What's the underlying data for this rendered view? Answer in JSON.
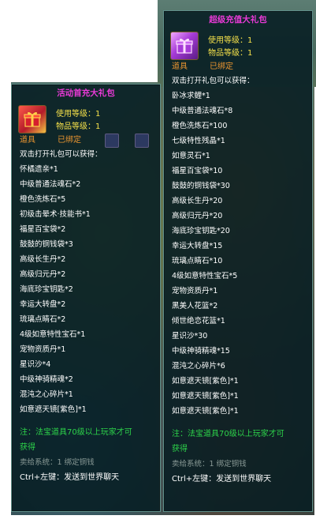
{
  "left_tooltip": {
    "title": "活动首充大礼包",
    "use_level": "使用等级：1",
    "item_level": "物品等级：1",
    "type_label": "道具",
    "bound_label": "已绑定",
    "description": "双击打开礼包可以获得：",
    "items": [
      "怀橘遗亲*1",
      "中级普通法魂石*2",
      "橙色洗炼石*5",
      "初级击晕术·技能书*1",
      "福星百宝袋*2",
      "鼓鼓的铜钱袋*3",
      "高级长生丹*2",
      "高级归元丹*2",
      "海底珍宝钥匙*2",
      "幸运大转盘*2",
      "琉璃点睛石*2",
      "4级如意特性宝石*1",
      "宠物资质丹*1",
      "星识沙*4",
      "中级神骑精魂*2",
      "混沌之心碎片*1",
      "如意遮天镜[紫色]*1"
    ],
    "note_line1": "注：法宝道具70级以上玩家才可",
    "note_line2": "获得",
    "sell_info": "卖给系统：1 绑定铜钱",
    "chat_hint": "Ctrl+左键：发送到世界聊天"
  },
  "right_tooltip": {
    "title": "超级充值大礼包",
    "use_level": "使用等级：1",
    "item_level": "物品等级：1",
    "type_label": "道具",
    "bound_label": "已绑定",
    "description": "双击打开礼包可以获得：",
    "items": [
      "卧冰求鲤*1",
      "中级普通法魂石*8",
      "橙色洗炼石*100",
      "七级特性残晶*1",
      "如意灵石*1",
      "福星百宝袋*10",
      "鼓鼓的铜钱袋*30",
      "高级长生丹*20",
      "高级归元丹*20",
      "海底珍宝钥匙*20",
      "幸运大转盘*15",
      "琉璃点睛石*10",
      "4级如意特性宝石*5",
      "宠物资质丹*1",
      "黑美人花篮*2",
      "倾世绝恋花篮*1",
      "星识沙*30",
      "中级神骑精魂*15",
      "混沌之心碎片*6",
      "如意遮天镜[紫色]*1",
      "如意遮天镜[紫色]*1",
      "如意遮天镜[紫色]*1"
    ],
    "note_line1": "注：法宝道具70级以上玩家才可",
    "note_line2": "获得",
    "sell_info": "卖给系统：1 绑定铜钱",
    "chat_hint": "Ctrl+左键：发送到世界聊天"
  },
  "colors": {
    "title": "#e83ad6",
    "level": "#f4e04a",
    "bound": "#e89430",
    "note": "#2dd34a",
    "sell": "#8a9a96",
    "panel_bg": "#061c22",
    "panel_border": "#5f8f8a"
  },
  "icons": {
    "left_item": "red-gift-box-icon",
    "right_item": "purple-gift-box-icon"
  }
}
